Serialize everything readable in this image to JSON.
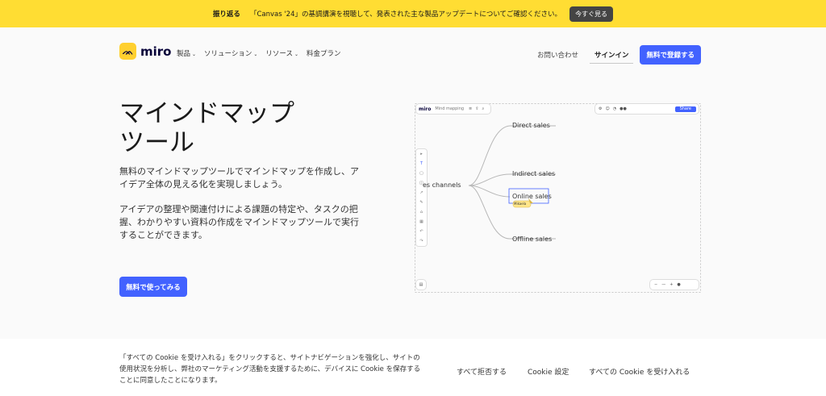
{
  "banner": {
    "lead": "振り返る",
    "message": "「Canvas '24」の基調講演を視聴して、発表された主な製品アップデートについてご確認ください。",
    "button": "今すぐ見る"
  },
  "nav": {
    "brand": "miro",
    "menu": [
      {
        "label": "製品"
      },
      {
        "label": "ソリューション"
      },
      {
        "label": "リソース"
      },
      {
        "label": "料金プラン"
      }
    ],
    "contact": "お問い合わせ",
    "signin": "サインイン",
    "signup": "無料で登録する"
  },
  "hero": {
    "title_line1": "マインドマップ",
    "title_line2": "ツール",
    "desc1": "無料のマインドマップツールでマインドマップを作成し、アイデア全体の見える化を実現しましょう。",
    "desc2": "アイデアの整理や関連付けによる課題の特定や、タスクの把握、わかりやすい資料の作成をマインドマップツールで実行することができます。",
    "cta": "無料で使ってみる"
  },
  "board": {
    "brand": "miro",
    "board_name": "Mind mapping",
    "root": "es channels",
    "nodes": [
      "Direct sales",
      "Indirect sales",
      "Online sales",
      "Offline sales"
    ],
    "cursor_name": "Mikaela",
    "share_label": "Share"
  },
  "cookie": {
    "text": "「すべての Cookie を受け入れる」をクリックすると、サイトナビゲーションを強化し、サイトの使用状況を分析し、弊社のマーケティング活動を支援するために、デバイスに Cookie を保存することに同意したことになります。",
    "reject": "すべて拒否する",
    "settings": "Cookie 設定",
    "accept": "すべての Cookie を受け入れる"
  }
}
